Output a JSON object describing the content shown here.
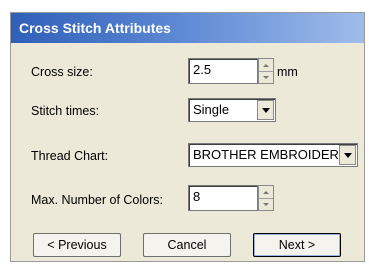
{
  "window": {
    "title": "Cross Stitch Attributes"
  },
  "cross_size": {
    "label": "Cross size:",
    "value": "2.5",
    "unit": "mm"
  },
  "stitch_times": {
    "label": "Stitch times:",
    "value": "Single"
  },
  "thread_chart": {
    "label": "Thread Chart:",
    "value": "BROTHER EMBROIDERY"
  },
  "max_colors": {
    "label": "Max. Number of Colors:",
    "value": "8"
  },
  "buttons": {
    "previous": "< Previous",
    "cancel": "Cancel",
    "next": "Next >"
  }
}
